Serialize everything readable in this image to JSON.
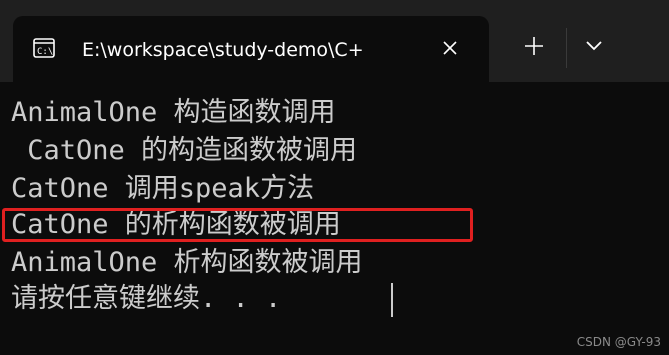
{
  "window": {
    "tab_title": "E:\\workspace\\study-demo\\C+",
    "icons": {
      "tab": "command-prompt-icon",
      "close": "close-icon",
      "new_tab": "plus-icon",
      "dropdown": "chevron-down-icon"
    }
  },
  "terminal": {
    "lines": [
      "AnimalOne 构造函数调用",
      " CatOne 的构造函数被调用",
      "CatOne 调用speak方法",
      "CatOne 的析构函数被调用",
      "AnimalOne 析构函数被调用",
      "请按任意键继续. . ."
    ]
  },
  "watermark": "CSDN @GY-93",
  "colors": {
    "highlight": "#e02020",
    "terminal_bg": "#0c0c0c",
    "text": "#cccccc"
  }
}
